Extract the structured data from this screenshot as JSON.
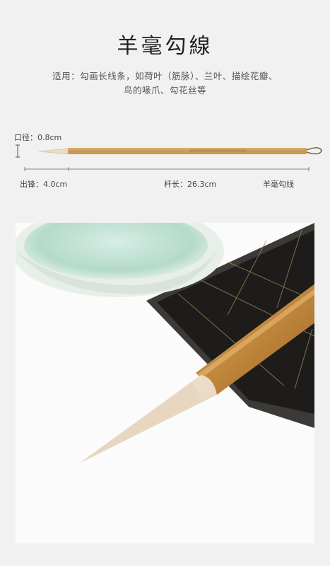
{
  "header": {
    "title": "羊毫勾線",
    "description_line1": "适用：勾画长线条，如荷叶（筋脉）、兰叶、描绘花瓣、",
    "description_line2": "鸟的喙爪、勾花丝等"
  },
  "specs": {
    "diameter": "口径：0.8cm",
    "tip_length": "出锋：4.0cm",
    "shaft_length": "杆长：26.3cm",
    "brush_name": "羊毫勾线"
  },
  "colors": {
    "background": "#f1f1f1",
    "bamboo": "#c99a55",
    "bristle": "#ead9c4",
    "celadon": "#bfe0d4"
  }
}
